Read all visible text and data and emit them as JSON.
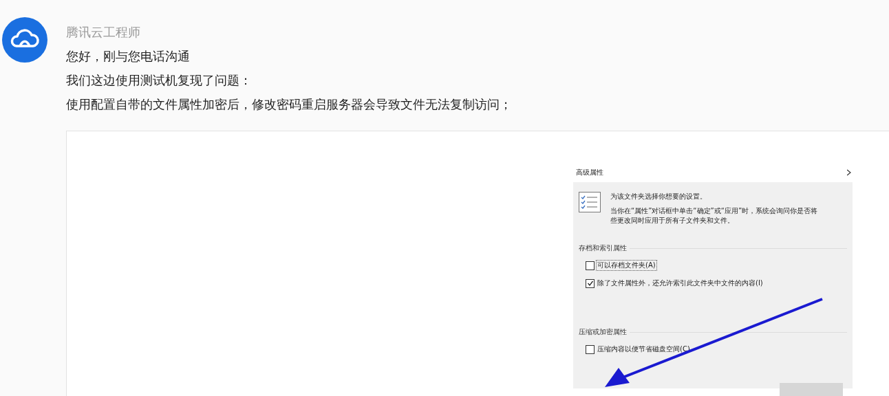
{
  "message": {
    "sender": "腾讯云工程师",
    "lines": [
      "您好，刚与您电话沟通",
      "我们这边使用测试机复现了问题：",
      "使用配置自带的文件属性加密后，修改密码重启服务器会导致文件无法复制访问；"
    ],
    "screenshot": {
      "dialog": {
        "title": "高级属性",
        "intro": [
          "为该文件夹选择你想要的设置。",
          "当你在“属性”对话框中单击“确定”或“应用”时，系统会询问你是否将",
          "些更改同时应用于所有子文件夹和文件。"
        ],
        "sections": [
          {
            "title": "存档和索引属性",
            "options": [
              {
                "label": "可以存档文件夹(A)",
                "checked": false,
                "focused": true
              },
              {
                "label": "除了文件属性外，还允许索引此文件夹中文件的内容(I)",
                "checked": true,
                "focused": false
              }
            ]
          },
          {
            "title": "压缩或加密属性",
            "options": [
              {
                "label": "压缩内容以便节省磁盘空间(C)",
                "checked": false,
                "focused": false
              }
            ]
          }
        ]
      }
    }
  }
}
